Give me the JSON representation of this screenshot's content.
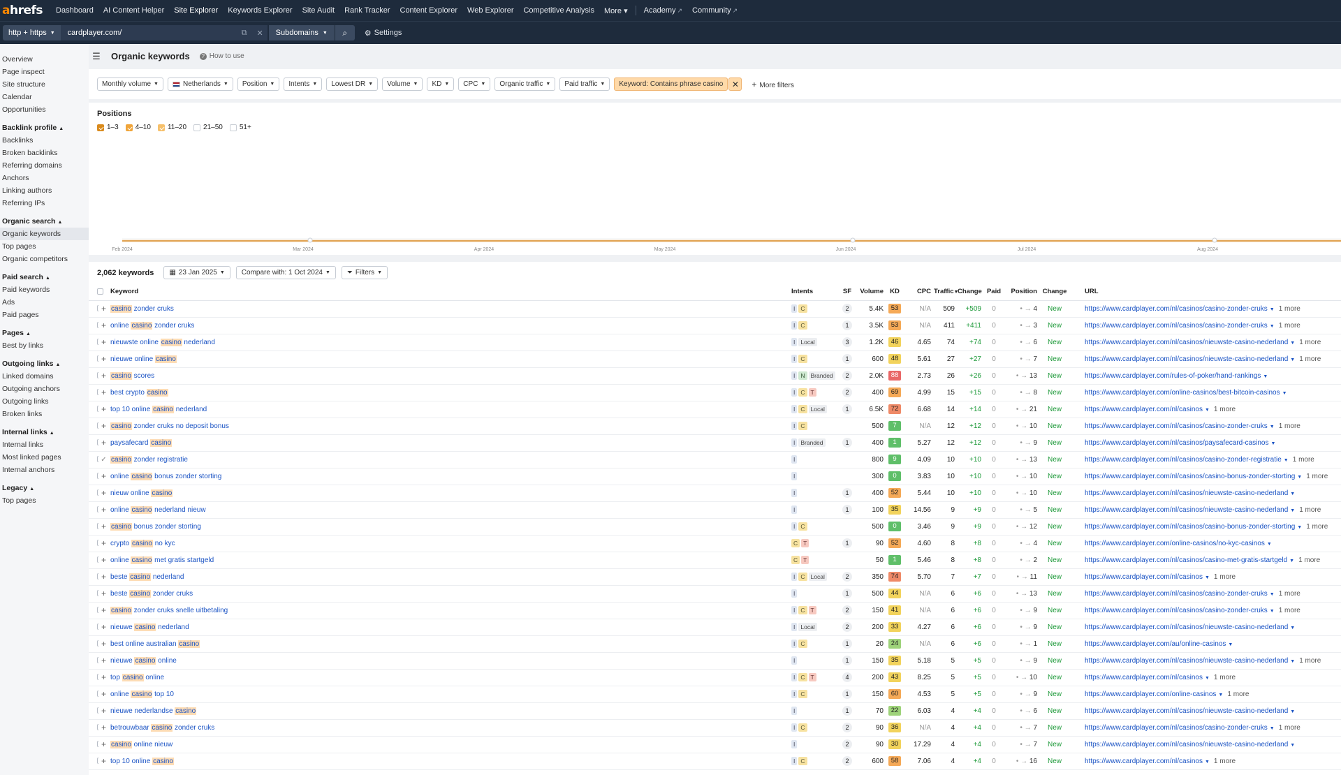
{
  "nav": {
    "logo_a": "a",
    "logo_rest": "hrefs",
    "links": [
      "Dashboard",
      "AI Content Helper",
      "Site Explorer",
      "Keywords Explorer",
      "Site Audit",
      "Rank Tracker",
      "Content Explorer",
      "Web Explorer",
      "Competitive Analysis",
      "More"
    ],
    "academy": "Academy",
    "community": "Community"
  },
  "search": {
    "protocol": "http + https",
    "url": "cardplayer.com/",
    "mode": "Subdomains",
    "settings": "Settings"
  },
  "sidebar": {
    "top": [
      "Overview",
      "Page inspect",
      "Site structure",
      "Calendar",
      "Opportunities"
    ],
    "sections": [
      {
        "title": "Backlink profile",
        "items": [
          "Backlinks",
          "Broken backlinks",
          "Referring domains",
          "Anchors",
          "Linking authors",
          "Referring IPs"
        ]
      },
      {
        "title": "Organic search",
        "items": [
          "Organic keywords",
          "Top pages",
          "Organic competitors"
        ]
      },
      {
        "title": "Paid search",
        "items": [
          "Paid keywords",
          "Ads",
          "Paid pages"
        ]
      },
      {
        "title": "Pages",
        "items": [
          "Best by links"
        ]
      },
      {
        "title": "Outgoing links",
        "items": [
          "Linked domains",
          "Outgoing anchors",
          "Outgoing links",
          "Broken links"
        ]
      },
      {
        "title": "Internal links",
        "items": [
          "Internal links",
          "Most linked pages",
          "Internal anchors"
        ]
      },
      {
        "title": "Legacy",
        "items": [
          "Top pages"
        ]
      }
    ]
  },
  "page": {
    "title": "Organic keywords",
    "how_to": "How to use"
  },
  "filters": {
    "buttons": [
      "Monthly volume",
      "Netherlands",
      "Position",
      "Intents",
      "Lowest DR",
      "Volume",
      "KD",
      "CPC",
      "Organic traffic",
      "Paid traffic"
    ],
    "keyword_filter": "Keyword: Contains phrase casino",
    "more": "More filters"
  },
  "chart": {
    "title": "Positions",
    "legend": [
      {
        "label": "1–3",
        "color": "#d98a1c",
        "on": true
      },
      {
        "label": "4–10",
        "color": "#f0a53a",
        "on": true
      },
      {
        "label": "11–20",
        "color": "#f6c06b",
        "on": true
      },
      {
        "label": "21–50",
        "color": "#d5d9df",
        "on": false
      },
      {
        "label": "51+",
        "color": "#e4e7eb",
        "on": false
      }
    ],
    "x_labels": [
      "Feb 2024",
      "Mar 2024",
      "Apr 2024",
      "May 2024",
      "Jun 2024",
      "Jul 2024",
      "Aug 2024"
    ]
  },
  "table": {
    "count": "2,062 keywords",
    "date": "23 Jan 2025",
    "compare": "Compare with: 1 Oct 2024",
    "filters": "Filters",
    "headers": {
      "keyword": "Keyword",
      "intents": "Intents",
      "sf": "SF",
      "volume": "Volume",
      "kd": "KD",
      "cpc": "CPC",
      "traffic": "Traffic",
      "change": "Change",
      "paid": "Paid",
      "position": "Position",
      "change2": "Change",
      "url": "URL"
    },
    "rows": [
      {
        "pre": "",
        "hl": "casino",
        "post": " zonder cruks",
        "intents": [
          "I",
          "C"
        ],
        "sf": "2",
        "vol": "5.4K",
        "kd": "53",
        "cpc": "N/A",
        "traffic": "509",
        "chg": "+509",
        "paid": "0",
        "pos": "4",
        "status": "New",
        "url": "https://www.cardplayer.com/nl/casinos/casino-zonder-cruks",
        "more": "1 more"
      },
      {
        "pre": "online ",
        "hl": "casino",
        "post": " zonder cruks",
        "intents": [
          "I",
          "C"
        ],
        "sf": "1",
        "vol": "3.5K",
        "kd": "53",
        "cpc": "N/A",
        "traffic": "411",
        "chg": "+411",
        "paid": "0",
        "pos": "3",
        "status": "New",
        "url": "https://www.cardplayer.com/nl/casinos/casino-zonder-cruks",
        "more": "1 more"
      },
      {
        "pre": "nieuwste online ",
        "hl": "casino",
        "post": " nederland",
        "intents": [
          "I",
          "Local"
        ],
        "sf": "3",
        "vol": "1.2K",
        "kd": "46",
        "cpc": "4.65",
        "traffic": "74",
        "chg": "+74",
        "paid": "0",
        "pos": "6",
        "status": "New",
        "url": "https://www.cardplayer.com/nl/casinos/nieuwste-casino-nederland",
        "more": "1 more"
      },
      {
        "pre": "nieuwe online ",
        "hl": "casino",
        "post": "",
        "intents": [
          "I",
          "C"
        ],
        "sf": "1",
        "vol": "600",
        "kd": "48",
        "cpc": "5.61",
        "traffic": "27",
        "chg": "+27",
        "paid": "0",
        "pos": "7",
        "status": "New",
        "url": "https://www.cardplayer.com/nl/casinos/nieuwste-casino-nederland",
        "more": "1 more"
      },
      {
        "pre": "",
        "hl": "casino",
        "post": " scores",
        "intents": [
          "I",
          "N",
          "Branded"
        ],
        "sf": "2",
        "vol": "2.0K",
        "kd": "88",
        "cpc": "2.73",
        "traffic": "26",
        "chg": "+26",
        "paid": "0",
        "pos": "13",
        "status": "New",
        "url": "https://www.cardplayer.com/rules-of-poker/hand-rankings",
        "more": ""
      },
      {
        "pre": "best crypto ",
        "hl": "casino",
        "post": "",
        "intents": [
          "I",
          "C",
          "T"
        ],
        "sf": "2",
        "vol": "400",
        "kd": "69",
        "cpc": "4.99",
        "traffic": "15",
        "chg": "+15",
        "paid": "0",
        "pos": "8",
        "status": "New",
        "url": "https://www.cardplayer.com/online-casinos/best-bitcoin-casinos",
        "more": ""
      },
      {
        "pre": "top 10 online ",
        "hl": "casino",
        "post": " nederland",
        "intents": [
          "I",
          "C",
          "Local"
        ],
        "sf": "1",
        "vol": "6.5K",
        "kd": "72",
        "cpc": "6.68",
        "traffic": "14",
        "chg": "+14",
        "paid": "0",
        "pos": "21",
        "status": "New",
        "url": "https://www.cardplayer.com/nl/casinos",
        "more": "1 more"
      },
      {
        "pre": "",
        "hl": "casino",
        "post": " zonder cruks no deposit bonus",
        "intents": [
          "I",
          "C"
        ],
        "sf": "",
        "vol": "500",
        "kd": "7",
        "cpc": "N/A",
        "traffic": "12",
        "chg": "+12",
        "paid": "0",
        "pos": "10",
        "status": "New",
        "url": "https://www.cardplayer.com/nl/casinos/casino-zonder-cruks",
        "more": "1 more"
      },
      {
        "pre": "paysafecard ",
        "hl": "casino",
        "post": "",
        "intents": [
          "I",
          "Branded"
        ],
        "sf": "1",
        "vol": "400",
        "kd": "1",
        "cpc": "5.27",
        "traffic": "12",
        "chg": "+12",
        "paid": "0",
        "pos": "9",
        "status": "New",
        "url": "https://www.cardplayer.com/nl/casinos/paysafecard-casinos",
        "more": ""
      },
      {
        "pre": "",
        "hl": "casino",
        "post": " zonder registratie",
        "intents": [
          "I"
        ],
        "sf": "",
        "vol": "800",
        "kd": "9",
        "cpc": "4.09",
        "traffic": "10",
        "chg": "+10",
        "paid": "0",
        "pos": "13",
        "status": "New",
        "url": "https://www.cardplayer.com/nl/casinos/casino-zonder-registratie",
        "more": "1 more",
        "tick": true
      },
      {
        "pre": "online ",
        "hl": "casino",
        "post": " bonus zonder storting",
        "intents": [
          "I"
        ],
        "sf": "",
        "vol": "300",
        "kd": "0",
        "cpc": "3.83",
        "traffic": "10",
        "chg": "+10",
        "paid": "0",
        "pos": "10",
        "status": "New",
        "url": "https://www.cardplayer.com/nl/casinos/casino-bonus-zonder-storting",
        "more": "1 more"
      },
      {
        "pre": "nieuw online ",
        "hl": "casino",
        "post": "",
        "intents": [
          "I"
        ],
        "sf": "1",
        "vol": "400",
        "kd": "52",
        "cpc": "5.44",
        "traffic": "10",
        "chg": "+10",
        "paid": "0",
        "pos": "10",
        "status": "New",
        "url": "https://www.cardplayer.com/nl/casinos/nieuwste-casino-nederland",
        "more": ""
      },
      {
        "pre": "online ",
        "hl": "casino",
        "post": " nederland nieuw",
        "intents": [
          "I"
        ],
        "sf": "1",
        "vol": "100",
        "kd": "35",
        "cpc": "14.56",
        "traffic": "9",
        "chg": "+9",
        "paid": "0",
        "pos": "5",
        "status": "New",
        "url": "https://www.cardplayer.com/nl/casinos/nieuwste-casino-nederland",
        "more": "1 more"
      },
      {
        "pre": "",
        "hl": "casino",
        "post": " bonus zonder storting",
        "intents": [
          "I",
          "C"
        ],
        "sf": "",
        "vol": "500",
        "kd": "0",
        "cpc": "3.46",
        "traffic": "9",
        "chg": "+9",
        "paid": "0",
        "pos": "12",
        "status": "New",
        "url": "https://www.cardplayer.com/nl/casinos/casino-bonus-zonder-storting",
        "more": "1 more"
      },
      {
        "pre": "crypto ",
        "hl": "casino",
        "post": " no kyc",
        "intents": [
          "C",
          "T"
        ],
        "sf": "1",
        "vol": "90",
        "kd": "52",
        "cpc": "4.60",
        "traffic": "8",
        "chg": "+8",
        "paid": "0",
        "pos": "4",
        "status": "New",
        "url": "https://www.cardplayer.com/online-casinos/no-kyc-casinos",
        "more": ""
      },
      {
        "pre": "online ",
        "hl": "casino",
        "post": " met gratis startgeld",
        "intents": [
          "C",
          "T"
        ],
        "sf": "",
        "vol": "50",
        "kd": "1",
        "cpc": "5.46",
        "traffic": "8",
        "chg": "+8",
        "paid": "0",
        "pos": "2",
        "status": "New",
        "url": "https://www.cardplayer.com/nl/casinos/casino-met-gratis-startgeld",
        "more": "1 more"
      },
      {
        "pre": "beste ",
        "hl": "casino",
        "post": " nederland",
        "intents": [
          "I",
          "C",
          "Local"
        ],
        "sf": "2",
        "vol": "350",
        "kd": "74",
        "cpc": "5.70",
        "traffic": "7",
        "chg": "+7",
        "paid": "0",
        "pos": "11",
        "status": "New",
        "url": "https://www.cardplayer.com/nl/casinos",
        "more": "1 more"
      },
      {
        "pre": "beste ",
        "hl": "casino",
        "post": " zonder cruks",
        "intents": [
          "I"
        ],
        "sf": "1",
        "vol": "500",
        "kd": "44",
        "cpc": "N/A",
        "traffic": "6",
        "chg": "+6",
        "paid": "0",
        "pos": "13",
        "status": "New",
        "url": "https://www.cardplayer.com/nl/casinos/casino-zonder-cruks",
        "more": "1 more"
      },
      {
        "pre": "",
        "hl": "casino",
        "post": " zonder cruks snelle uitbetaling",
        "intents": [
          "I",
          "C",
          "T"
        ],
        "sf": "2",
        "vol": "150",
        "kd": "41",
        "cpc": "N/A",
        "traffic": "6",
        "chg": "+6",
        "paid": "0",
        "pos": "9",
        "status": "New",
        "url": "https://www.cardplayer.com/nl/casinos/casino-zonder-cruks",
        "more": "1 more"
      },
      {
        "pre": "nieuwe ",
        "hl": "casino",
        "post": " nederland",
        "intents": [
          "I",
          "Local"
        ],
        "sf": "2",
        "vol": "200",
        "kd": "33",
        "cpc": "4.27",
        "traffic": "6",
        "chg": "+6",
        "paid": "0",
        "pos": "9",
        "status": "New",
        "url": "https://www.cardplayer.com/nl/casinos/nieuwste-casino-nederland",
        "more": ""
      },
      {
        "pre": "best online australian ",
        "hl": "casino",
        "post": "",
        "intents": [
          "I",
          "C"
        ],
        "sf": "1",
        "vol": "20",
        "kd": "24",
        "cpc": "N/A",
        "traffic": "6",
        "chg": "+6",
        "paid": "0",
        "pos": "1",
        "status": "New",
        "url": "https://www.cardplayer.com/au/online-casinos",
        "more": ""
      },
      {
        "pre": "nieuwe ",
        "hl": "casino",
        "post": " online",
        "intents": [
          "I"
        ],
        "sf": "1",
        "vol": "150",
        "kd": "35",
        "cpc": "5.18",
        "traffic": "5",
        "chg": "+5",
        "paid": "0",
        "pos": "9",
        "status": "New",
        "url": "https://www.cardplayer.com/nl/casinos/nieuwste-casino-nederland",
        "more": "1 more"
      },
      {
        "pre": "top ",
        "hl": "casino",
        "post": " online",
        "intents": [
          "I",
          "C",
          "T"
        ],
        "sf": "4",
        "vol": "200",
        "kd": "43",
        "cpc": "8.25",
        "traffic": "5",
        "chg": "+5",
        "paid": "0",
        "pos": "10",
        "status": "New",
        "url": "https://www.cardplayer.com/nl/casinos",
        "more": "1 more"
      },
      {
        "pre": "online ",
        "hl": "casino",
        "post": " top 10",
        "intents": [
          "I",
          "C"
        ],
        "sf": "1",
        "vol": "150",
        "kd": "60",
        "cpc": "4.53",
        "traffic": "5",
        "chg": "+5",
        "paid": "0",
        "pos": "9",
        "status": "New",
        "url": "https://www.cardplayer.com/online-casinos",
        "more": "1 more"
      },
      {
        "pre": "nieuwe nederlandse ",
        "hl": "casino",
        "post": "",
        "intents": [
          "I"
        ],
        "sf": "1",
        "vol": "70",
        "kd": "22",
        "cpc": "6.03",
        "traffic": "4",
        "chg": "+4",
        "paid": "0",
        "pos": "6",
        "status": "New",
        "url": "https://www.cardplayer.com/nl/casinos/nieuwste-casino-nederland",
        "more": ""
      },
      {
        "pre": "betrouwbaar ",
        "hl": "casino",
        "post": " zonder cruks",
        "intents": [
          "I",
          "C"
        ],
        "sf": "2",
        "vol": "90",
        "kd": "36",
        "cpc": "N/A",
        "traffic": "4",
        "chg": "+4",
        "paid": "0",
        "pos": "7",
        "status": "New",
        "url": "https://www.cardplayer.com/nl/casinos/casino-zonder-cruks",
        "more": "1 more"
      },
      {
        "pre": "",
        "hl": "casino",
        "post": " online nieuw",
        "intents": [
          "I"
        ],
        "sf": "2",
        "vol": "90",
        "kd": "30",
        "cpc": "17.29",
        "traffic": "4",
        "chg": "+4",
        "paid": "0",
        "pos": "7",
        "status": "New",
        "url": "https://www.cardplayer.com/nl/casinos/nieuwste-casino-nederland",
        "more": ""
      },
      {
        "pre": "top 10 online ",
        "hl": "casino",
        "post": "",
        "intents": [
          "I",
          "C"
        ],
        "sf": "2",
        "vol": "600",
        "kd": "58",
        "cpc": "7.06",
        "traffic": "4",
        "chg": "+4",
        "paid": "0",
        "pos": "16",
        "status": "New",
        "url": "https://www.cardplayer.com/nl/casinos",
        "more": "1 more"
      }
    ]
  }
}
